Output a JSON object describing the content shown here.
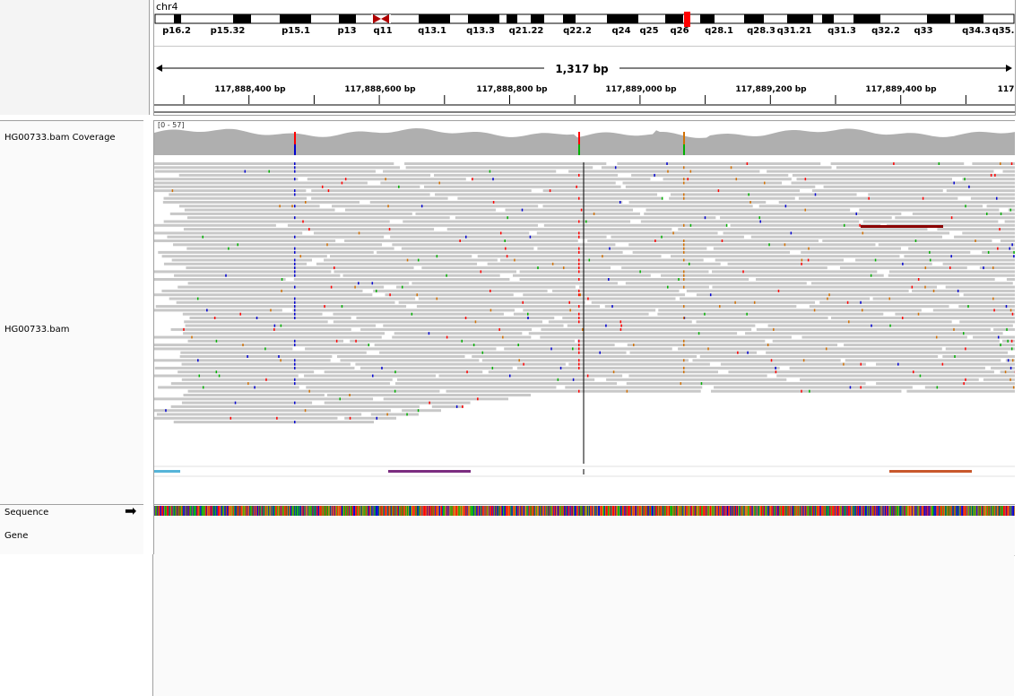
{
  "locus": {
    "chromosome": "chr4",
    "span_label": "1,317 bp",
    "bands": [
      "p16.2",
      "p15.32",
      "p15.1",
      "p13",
      "q11",
      "q13.1",
      "q13.3",
      "q21.22",
      "q22.2",
      "q24",
      "q25",
      "q26",
      "q28.1",
      "q28.3",
      "q31.21",
      "q31.3",
      "q32.2",
      "q33",
      "q34.3",
      "q35."
    ],
    "ruler_ticks": [
      "117,888,400 bp",
      "117,888,600 bp",
      "117,888,800 bp",
      "117,889,000 bp",
      "117,889,200 bp",
      "117,889,400 bp",
      "117"
    ]
  },
  "tracks": {
    "coverage_name": "HG00733.bam Coverage",
    "coverage_range": "[0 - 57]",
    "alignment_name": "HG00733.bam",
    "sequence_name": "Sequence",
    "gene_name": "Gene"
  },
  "colors": {
    "read_gray": "#c8c8c8",
    "coverage_gray": "#afafaf",
    "mismatch_A": "#00b000",
    "mismatch_C": "#0000d0",
    "mismatch_G": "#d17105",
    "mismatch_T": "#ff0000",
    "centromere": "#b00000",
    "highlight_band": "#ff0000",
    "feature_blue": "#56b4d9",
    "feature_purple": "#7b2d80",
    "feature_orange": "#c8582c",
    "split_read": "#8b0000"
  },
  "icons": {
    "sequence_strand": "right-arrow-icon"
  }
}
